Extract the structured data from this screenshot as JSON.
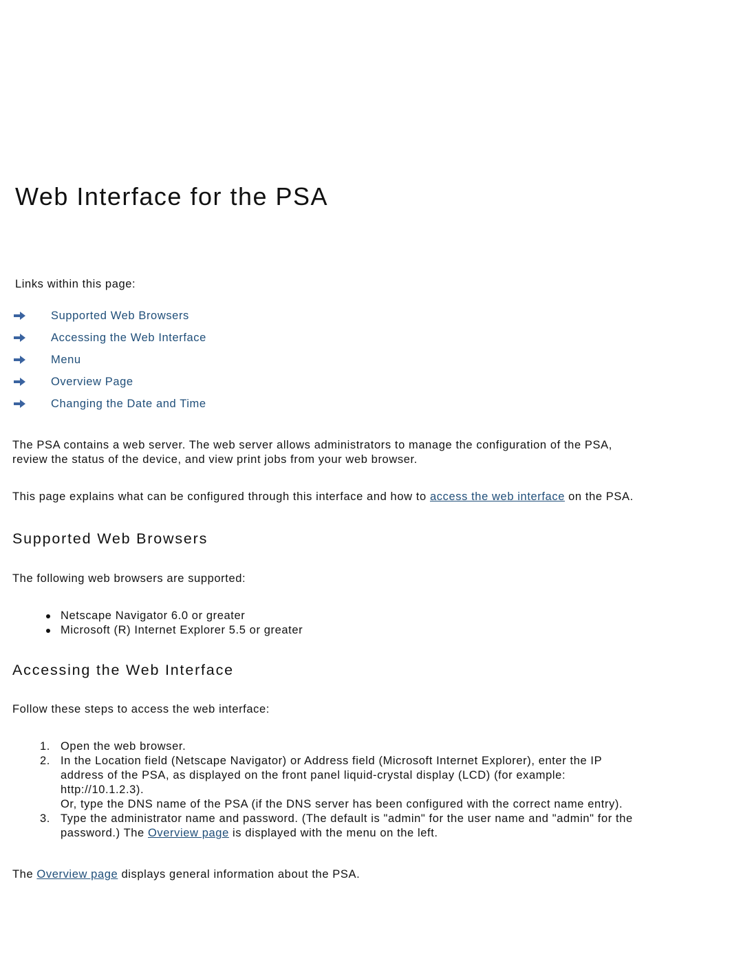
{
  "page": {
    "title": "Web Interface for the PSA",
    "links_heading": "Links within this page:",
    "toc": [
      {
        "label": "Supported Web Browsers",
        "icon": "arrow-right-icon"
      },
      {
        "label": "Accessing the Web Interface",
        "icon": "arrow-right-icon"
      },
      {
        "label": "Menu",
        "icon": "arrow-right-icon"
      },
      {
        "label": "Overview Page",
        "icon": "arrow-right-icon"
      },
      {
        "label": "Changing the Date and Time",
        "icon": "arrow-right-icon"
      }
    ],
    "intro": {
      "line1": "The PSA contains a web server. The web server allows administrators to manage the configuration of the PSA,",
      "line2": "review the status of the device, and view print jobs from your web browser.",
      "p2_before": "This page explains what can be configured through this interface and how to ",
      "p2_link": "access the web interface",
      "p2_after": " on the PSA."
    },
    "supported": {
      "heading": "Supported Web Browsers",
      "lead": "The following web browsers are supported:",
      "items": [
        "Netscape Navigator 6.0 or greater",
        "Microsoft (R) Internet Explorer 5.5 or greater"
      ]
    },
    "accessing": {
      "heading": "Accessing the Web Interface",
      "lead": "Follow these steps to access the web interface:",
      "steps": [
        {
          "num": "1.",
          "lines": [
            "Open the web browser."
          ]
        },
        {
          "num": "2.",
          "lines": [
            "In the Location field (Netscape Navigator) or Address field (Microsoft Internet Explorer), enter the IP",
            "address of the PSA, as displayed on the front panel liquid-crystal display (LCD) (for example:",
            "http://10.1.2.3).",
            "Or, type the DNS name of the PSA (if the DNS server has been configured with the correct name entry)."
          ]
        },
        {
          "num": "3.",
          "line1": "Type the administrator name and password. (The default is \"admin\" for the user name and \"admin\" for the",
          "line2_before": "password.) The ",
          "line2_link": "Overview page",
          "line2_after": " is displayed with the menu on the left."
        }
      ],
      "footer_before": "The ",
      "footer_link": "Overview page",
      "footer_after": " displays general information about the PSA."
    },
    "colors": {
      "link": "#1f4e79",
      "arrow": "#3a63a0",
      "text": "#111111"
    }
  }
}
